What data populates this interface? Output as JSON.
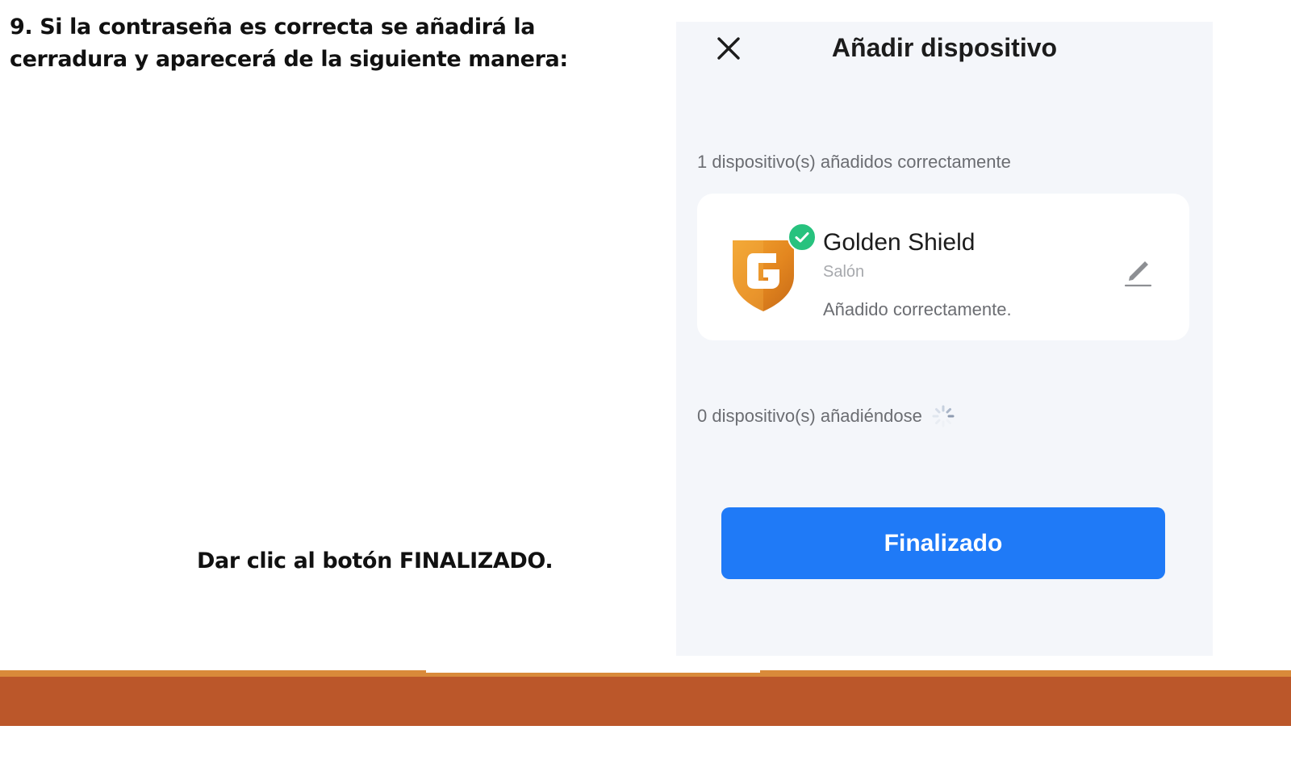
{
  "slide": {
    "instruction": "9. Si la contraseña es correcta se añadirá la cerradura y aparecerá de la siguiente manera:",
    "note": "Dar clic al botón FINALIZADO."
  },
  "phone": {
    "title": "Añadir dispositivo",
    "close_icon": "close-icon",
    "added_label": "1 dispositivo(s) añadidos correctamente",
    "device": {
      "name": "Golden Shield",
      "room": "Salón",
      "status": "Añadido correctamente.",
      "logo_icon": "golden-shield-logo-icon",
      "badge_icon": "check-icon",
      "edit_icon": "pencil-icon"
    },
    "adding_label": "0 dispositivo(s) añadiéndose",
    "spinner_icon": "loading-spinner-icon",
    "finish_button": "Finalizado"
  },
  "colors": {
    "phone_background": "#f4f6fa",
    "primary_button": "#1f7af7",
    "success_badge": "#27c27e",
    "footer_accent": "#d98a3a",
    "footer_band": "#bb572a",
    "shield_orange": "#e58a22"
  }
}
